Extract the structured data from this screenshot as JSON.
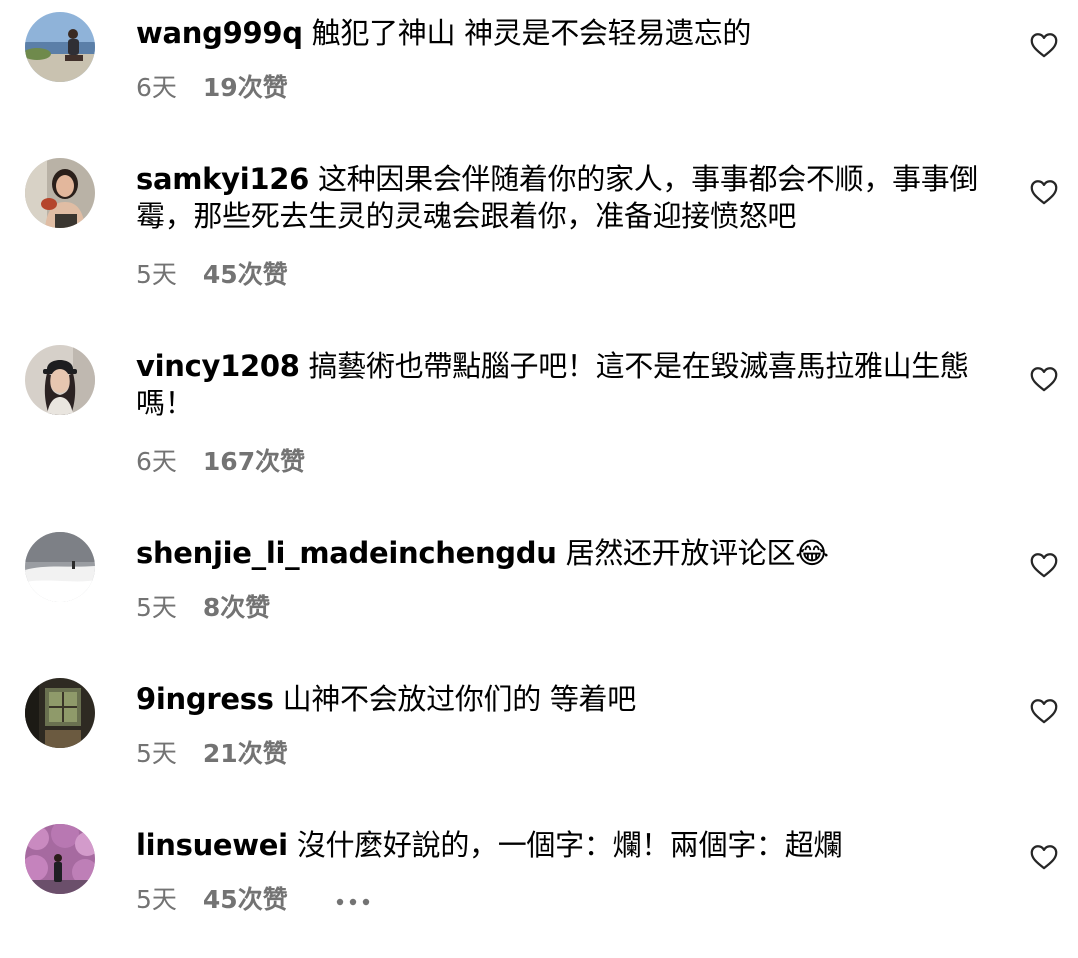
{
  "comments": [
    {
      "username": "wang999q",
      "text": "触犯了神山 神灵是不会轻易遗忘的",
      "time": "6天",
      "likes": "19次赞",
      "avatar_icon": "avatar-photo-coast",
      "liked": false
    },
    {
      "username": "samkyi126",
      "text": "这种因果会伴随着你的家人，事事都会不顺，事事倒霉，那些死去生灵的灵魂会跟着你，准备迎接愤怒吧",
      "time": "5天",
      "likes": "45次赞",
      "avatar_icon": "avatar-photo-woman-bird",
      "liked": false
    },
    {
      "username": "vincy1208",
      "text": "搞藝術也帶點腦子吧！這不是在毀滅喜馬拉雅山生態嗎！",
      "time": "6天",
      "likes": "167次赞",
      "avatar_icon": "avatar-photo-woman-cap",
      "liked": false
    },
    {
      "username": "shenjie_li_madeinchengdu",
      "text": "居然还开放评论区😂",
      "time": "5天",
      "likes": "8次赞",
      "avatar_icon": "avatar-photo-snow-field",
      "liked": false
    },
    {
      "username": "9ingress",
      "text": "山神不会放过你们的 等着吧",
      "time": "5天",
      "likes": "21次赞",
      "avatar_icon": "avatar-photo-window",
      "liked": false
    },
    {
      "username": "linsuewei",
      "text": "沒什麼好說的，一個字：爛！兩個字：超爛",
      "time": "5天",
      "likes": "45次赞",
      "avatar_icon": "avatar-photo-pink-flowers",
      "liked": false,
      "more_icon": "more-options-icon"
    }
  ],
  "colors": {
    "text": "#000000",
    "meta": "#737373",
    "heart_outline": "#262626"
  }
}
